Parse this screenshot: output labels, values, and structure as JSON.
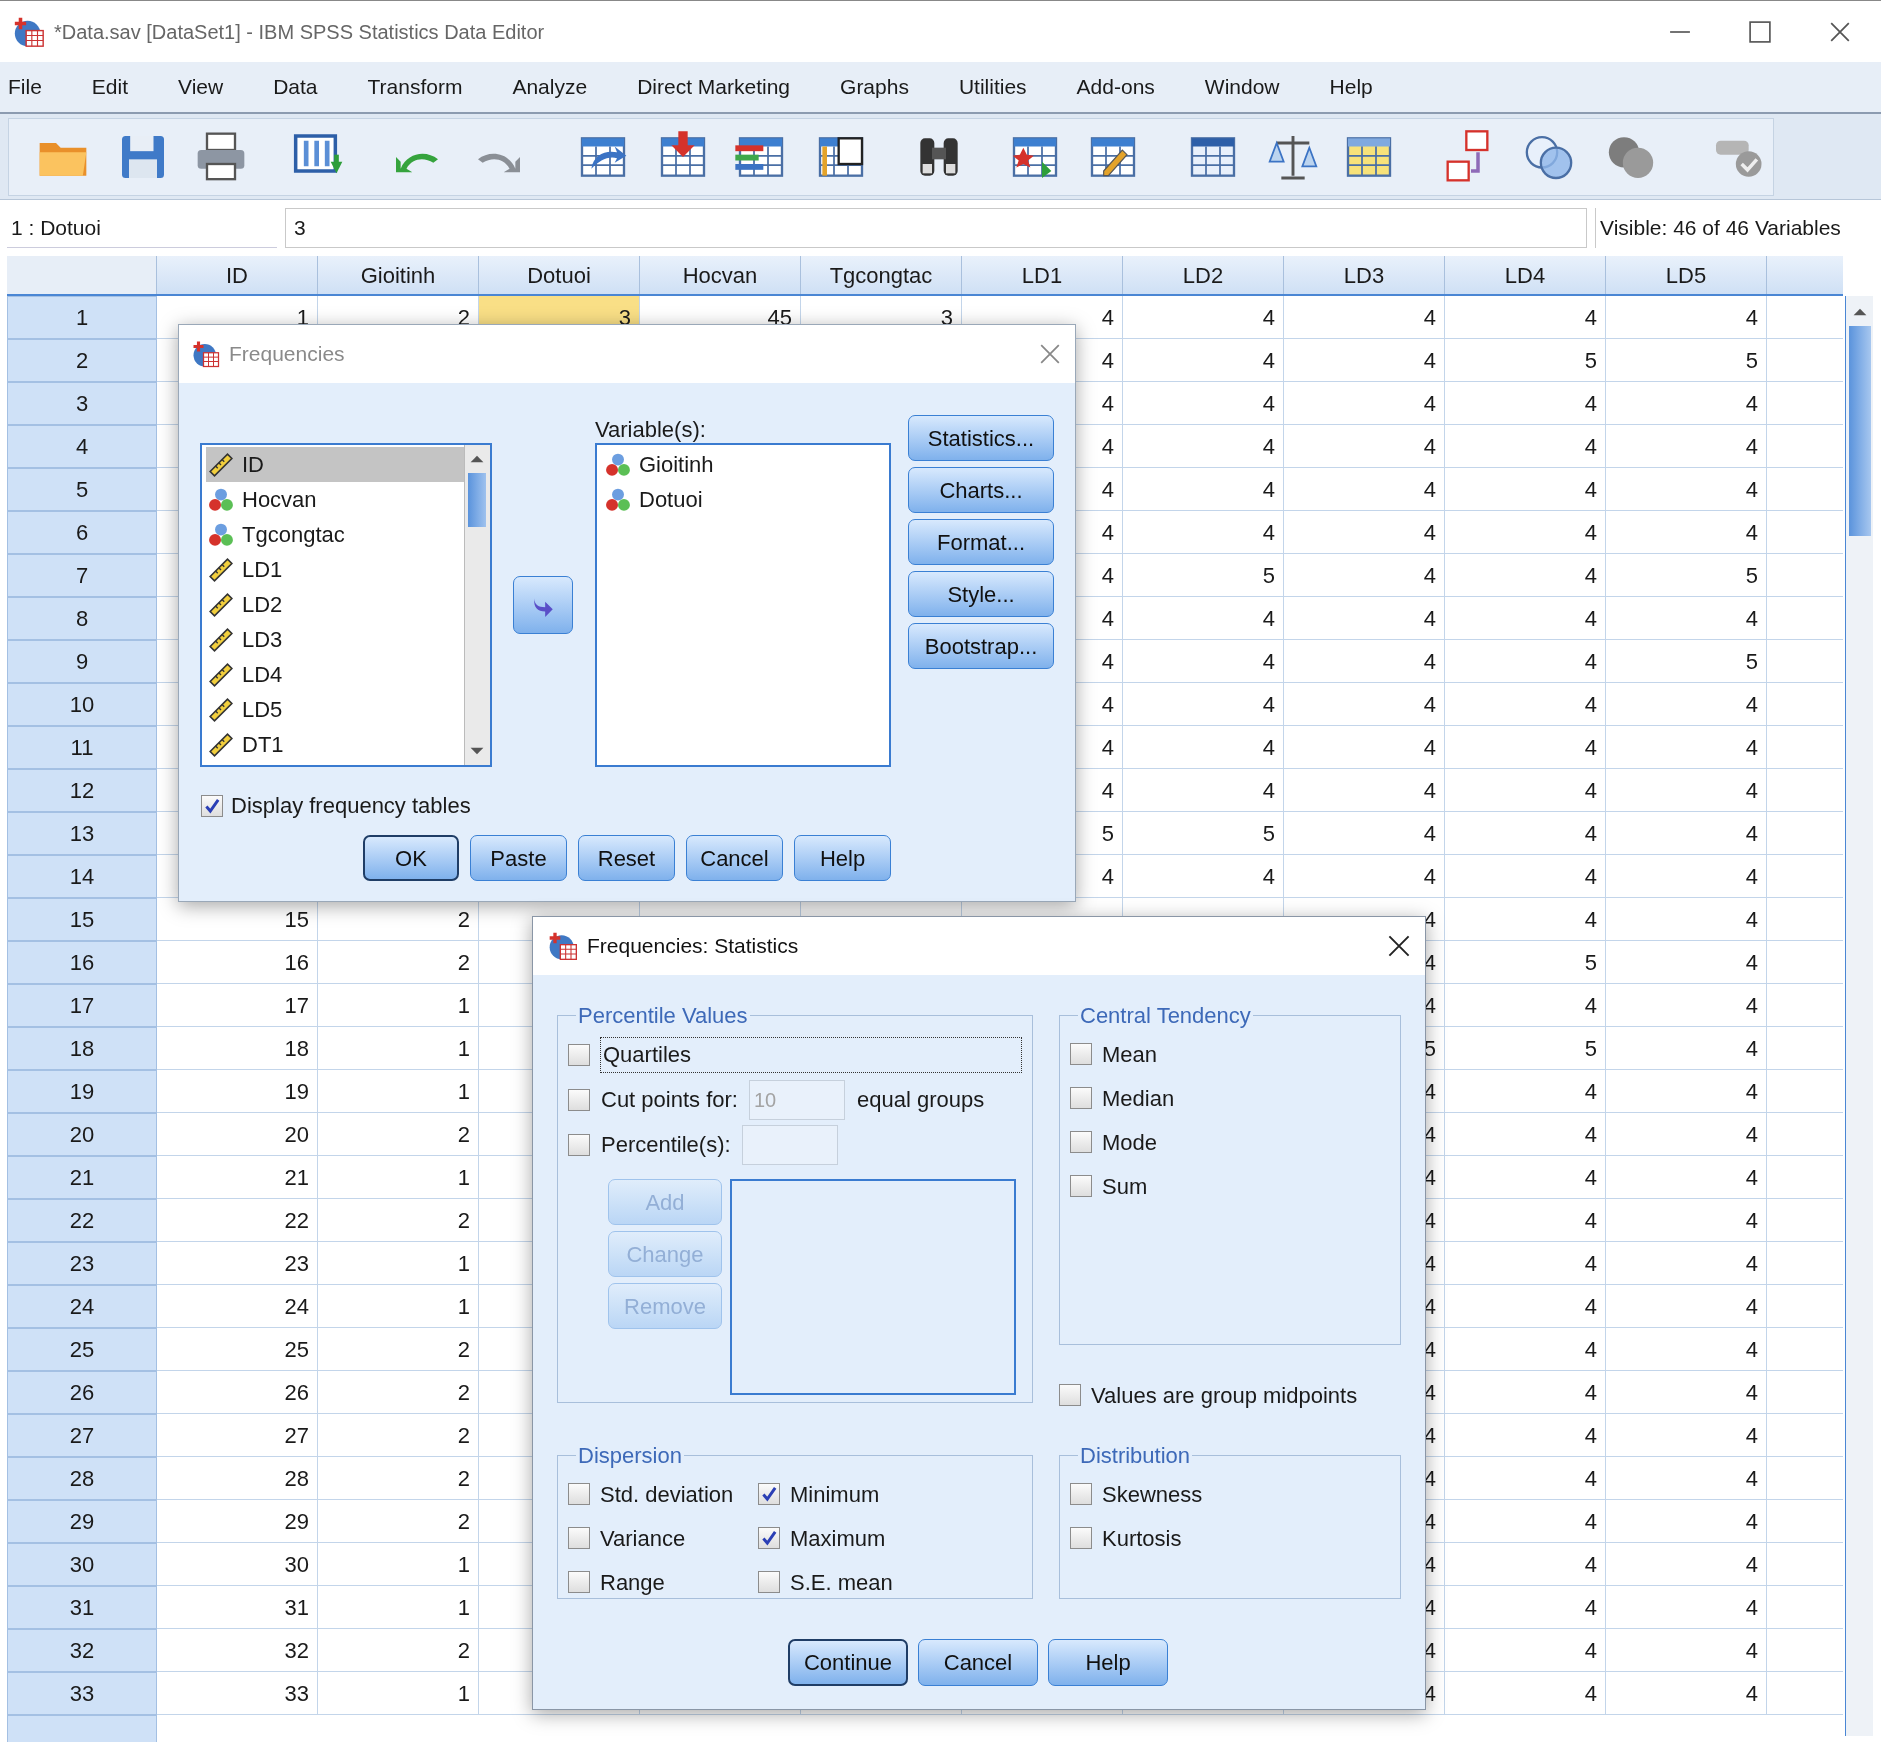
{
  "window": {
    "title": "*Data.sav [DataSet1] - IBM SPSS Statistics Data Editor"
  },
  "menu": [
    "File",
    "Edit",
    "View",
    "Data",
    "Transform",
    "Analyze",
    "Direct Marketing",
    "Graphs",
    "Utilities",
    "Add-ons",
    "Window",
    "Help"
  ],
  "cell_editor": {
    "cell_ref": "1 : Dotuoi",
    "value": "3",
    "visible_count": "Visible: 46 of 46 Variables"
  },
  "grid": {
    "columns": [
      {
        "label": "ID"
      },
      {
        "label": "Gioitinh"
      },
      {
        "label": "Dotuoi"
      },
      {
        "label": "Hocvan"
      },
      {
        "label": "Tgcongtac"
      },
      {
        "label": "LD1"
      },
      {
        "label": "LD2"
      },
      {
        "label": "LD3"
      },
      {
        "label": "LD4"
      },
      {
        "label": "LD5"
      }
    ],
    "rows": [
      {
        "label": "1",
        "cells": [
          {
            "value": "1",
            "selected": false
          },
          {
            "value": "2",
            "selected": false
          },
          {
            "value": "3",
            "selected": true
          },
          {
            "value": "45",
            "selected": false
          },
          {
            "value": "3",
            "selected": false
          },
          {
            "value": "4",
            "selected": false
          },
          {
            "value": "4",
            "selected": false
          },
          {
            "value": "4",
            "selected": false
          },
          {
            "value": "4",
            "selected": false
          },
          {
            "value": "4",
            "selected": false
          }
        ]
      },
      {
        "label": "2",
        "cells": [
          null,
          null,
          null,
          null,
          null,
          {
            "value": "4",
            "selected": false
          },
          {
            "value": "4",
            "selected": false
          },
          {
            "value": "4",
            "selected": false
          },
          {
            "value": "5",
            "selected": false
          },
          {
            "value": "5",
            "selected": false
          }
        ]
      },
      {
        "label": "3",
        "cells": [
          null,
          null,
          null,
          null,
          null,
          {
            "value": "4",
            "selected": false
          },
          {
            "value": "4",
            "selected": false
          },
          {
            "value": "4",
            "selected": false
          },
          {
            "value": "4",
            "selected": false
          },
          {
            "value": "4",
            "selected": false
          }
        ]
      },
      {
        "label": "4",
        "cells": [
          null,
          null,
          null,
          null,
          null,
          {
            "value": "4",
            "selected": false
          },
          {
            "value": "4",
            "selected": false
          },
          {
            "value": "4",
            "selected": false
          },
          {
            "value": "4",
            "selected": false
          },
          {
            "value": "4",
            "selected": false
          }
        ]
      },
      {
        "label": "5",
        "cells": [
          null,
          null,
          null,
          null,
          null,
          {
            "value": "4",
            "selected": false
          },
          {
            "value": "4",
            "selected": false
          },
          {
            "value": "4",
            "selected": false
          },
          {
            "value": "4",
            "selected": false
          },
          {
            "value": "4",
            "selected": false
          }
        ]
      },
      {
        "label": "6",
        "cells": [
          null,
          null,
          null,
          null,
          null,
          {
            "value": "4",
            "selected": false
          },
          {
            "value": "4",
            "selected": false
          },
          {
            "value": "4",
            "selected": false
          },
          {
            "value": "4",
            "selected": false
          },
          {
            "value": "4",
            "selected": false
          }
        ]
      },
      {
        "label": "7",
        "cells": [
          null,
          null,
          null,
          null,
          null,
          {
            "value": "4",
            "selected": false
          },
          {
            "value": "5",
            "selected": false
          },
          {
            "value": "4",
            "selected": false
          },
          {
            "value": "4",
            "selected": false
          },
          {
            "value": "5",
            "selected": false
          }
        ]
      },
      {
        "label": "8",
        "cells": [
          null,
          null,
          null,
          null,
          null,
          {
            "value": "4",
            "selected": false
          },
          {
            "value": "4",
            "selected": false
          },
          {
            "value": "4",
            "selected": false
          },
          {
            "value": "4",
            "selected": false
          },
          {
            "value": "4",
            "selected": false
          }
        ]
      },
      {
        "label": "9",
        "cells": [
          null,
          null,
          null,
          null,
          null,
          {
            "value": "4",
            "selected": false
          },
          {
            "value": "4",
            "selected": false
          },
          {
            "value": "4",
            "selected": false
          },
          {
            "value": "4",
            "selected": false
          },
          {
            "value": "5",
            "selected": false
          }
        ]
      },
      {
        "label": "10",
        "cells": [
          null,
          null,
          null,
          null,
          null,
          {
            "value": "4",
            "selected": false
          },
          {
            "value": "4",
            "selected": false
          },
          {
            "value": "4",
            "selected": false
          },
          {
            "value": "4",
            "selected": false
          },
          {
            "value": "4",
            "selected": false
          }
        ]
      },
      {
        "label": "11",
        "cells": [
          null,
          null,
          null,
          null,
          null,
          {
            "value": "4",
            "selected": false
          },
          {
            "value": "4",
            "selected": false
          },
          {
            "value": "4",
            "selected": false
          },
          {
            "value": "4",
            "selected": false
          },
          {
            "value": "4",
            "selected": false
          }
        ]
      },
      {
        "label": "12",
        "cells": [
          null,
          null,
          null,
          null,
          null,
          {
            "value": "4",
            "selected": false
          },
          {
            "value": "4",
            "selected": false
          },
          {
            "value": "4",
            "selected": false
          },
          {
            "value": "4",
            "selected": false
          },
          {
            "value": "4",
            "selected": false
          }
        ]
      },
      {
        "label": "13",
        "cells": [
          null,
          null,
          null,
          null,
          null,
          {
            "value": "5",
            "selected": false
          },
          {
            "value": "5",
            "selected": false
          },
          {
            "value": "4",
            "selected": false
          },
          {
            "value": "4",
            "selected": false
          },
          {
            "value": "4",
            "selected": false
          }
        ]
      },
      {
        "label": "14",
        "cells": [
          null,
          null,
          null,
          null,
          null,
          {
            "value": "4",
            "selected": false
          },
          {
            "value": "4",
            "selected": false
          },
          {
            "value": "4",
            "selected": false
          },
          {
            "value": "4",
            "selected": false
          },
          {
            "value": "4",
            "selected": false
          }
        ]
      },
      {
        "label": "15",
        "cells": [
          {
            "value": "15",
            "selected": false
          },
          {
            "value": "2",
            "selected": false
          },
          null,
          null,
          null,
          null,
          null,
          {
            "value": "4",
            "selected": false
          },
          {
            "value": "4",
            "selected": false
          },
          {
            "value": "4",
            "selected": false
          }
        ]
      },
      {
        "label": "16",
        "cells": [
          {
            "value": "16",
            "selected": false
          },
          {
            "value": "2",
            "selected": false
          },
          null,
          null,
          null,
          null,
          null,
          {
            "value": "4",
            "selected": false
          },
          {
            "value": "5",
            "selected": false
          },
          {
            "value": "4",
            "selected": false
          }
        ]
      },
      {
        "label": "17",
        "cells": [
          {
            "value": "17",
            "selected": false
          },
          {
            "value": "1",
            "selected": false
          },
          null,
          null,
          null,
          null,
          null,
          {
            "value": "4",
            "selected": false
          },
          {
            "value": "4",
            "selected": false
          },
          {
            "value": "4",
            "selected": false
          }
        ]
      },
      {
        "label": "18",
        "cells": [
          {
            "value": "18",
            "selected": false
          },
          {
            "value": "1",
            "selected": false
          },
          null,
          null,
          null,
          null,
          null,
          {
            "value": "5",
            "selected": false
          },
          {
            "value": "5",
            "selected": false
          },
          {
            "value": "4",
            "selected": false
          }
        ]
      },
      {
        "label": "19",
        "cells": [
          {
            "value": "19",
            "selected": false
          },
          {
            "value": "1",
            "selected": false
          },
          null,
          null,
          null,
          null,
          null,
          {
            "value": "4",
            "selected": false
          },
          {
            "value": "4",
            "selected": false
          },
          {
            "value": "4",
            "selected": false
          }
        ]
      },
      {
        "label": "20",
        "cells": [
          {
            "value": "20",
            "selected": false
          },
          {
            "value": "2",
            "selected": false
          },
          null,
          null,
          null,
          null,
          null,
          {
            "value": "4",
            "selected": false
          },
          {
            "value": "4",
            "selected": false
          },
          {
            "value": "4",
            "selected": false
          }
        ]
      },
      {
        "label": "21",
        "cells": [
          {
            "value": "21",
            "selected": false
          },
          {
            "value": "1",
            "selected": false
          },
          null,
          null,
          null,
          null,
          null,
          {
            "value": "4",
            "selected": false
          },
          {
            "value": "4",
            "selected": false
          },
          {
            "value": "4",
            "selected": false
          }
        ]
      },
      {
        "label": "22",
        "cells": [
          {
            "value": "22",
            "selected": false
          },
          {
            "value": "2",
            "selected": false
          },
          null,
          null,
          null,
          null,
          null,
          {
            "value": "4",
            "selected": false
          },
          {
            "value": "4",
            "selected": false
          },
          {
            "value": "4",
            "selected": false
          }
        ]
      },
      {
        "label": "23",
        "cells": [
          {
            "value": "23",
            "selected": false
          },
          {
            "value": "1",
            "selected": false
          },
          null,
          null,
          null,
          null,
          null,
          {
            "value": "4",
            "selected": false
          },
          {
            "value": "4",
            "selected": false
          },
          {
            "value": "4",
            "selected": false
          }
        ]
      },
      {
        "label": "24",
        "cells": [
          {
            "value": "24",
            "selected": false
          },
          {
            "value": "1",
            "selected": false
          },
          null,
          null,
          null,
          null,
          null,
          {
            "value": "4",
            "selected": false
          },
          {
            "value": "4",
            "selected": false
          },
          {
            "value": "4",
            "selected": false
          }
        ]
      },
      {
        "label": "25",
        "cells": [
          {
            "value": "25",
            "selected": false
          },
          {
            "value": "2",
            "selected": false
          },
          null,
          null,
          null,
          null,
          null,
          {
            "value": "4",
            "selected": false
          },
          {
            "value": "4",
            "selected": false
          },
          {
            "value": "4",
            "selected": false
          }
        ]
      },
      {
        "label": "26",
        "cells": [
          {
            "value": "26",
            "selected": false
          },
          {
            "value": "2",
            "selected": false
          },
          null,
          null,
          null,
          null,
          null,
          {
            "value": "4",
            "selected": false
          },
          {
            "value": "4",
            "selected": false
          },
          {
            "value": "4",
            "selected": false
          }
        ]
      },
      {
        "label": "27",
        "cells": [
          {
            "value": "27",
            "selected": false
          },
          {
            "value": "2",
            "selected": false
          },
          null,
          null,
          null,
          null,
          null,
          {
            "value": "4",
            "selected": false
          },
          {
            "value": "4",
            "selected": false
          },
          {
            "value": "4",
            "selected": false
          }
        ]
      },
      {
        "label": "28",
        "cells": [
          {
            "value": "28",
            "selected": false
          },
          {
            "value": "2",
            "selected": false
          },
          null,
          null,
          null,
          null,
          null,
          {
            "value": "4",
            "selected": false
          },
          {
            "value": "4",
            "selected": false
          },
          {
            "value": "4",
            "selected": false
          }
        ]
      },
      {
        "label": "29",
        "cells": [
          {
            "value": "29",
            "selected": false
          },
          {
            "value": "2",
            "selected": false
          },
          null,
          null,
          null,
          null,
          null,
          {
            "value": "4",
            "selected": false
          },
          {
            "value": "4",
            "selected": false
          },
          {
            "value": "4",
            "selected": false
          }
        ]
      },
      {
        "label": "30",
        "cells": [
          {
            "value": "30",
            "selected": false
          },
          {
            "value": "1",
            "selected": false
          },
          null,
          null,
          null,
          null,
          null,
          {
            "value": "4",
            "selected": false
          },
          {
            "value": "4",
            "selected": false
          },
          {
            "value": "4",
            "selected": false
          }
        ]
      },
      {
        "label": "31",
        "cells": [
          {
            "value": "31",
            "selected": false
          },
          {
            "value": "1",
            "selected": false
          },
          null,
          null,
          null,
          null,
          null,
          {
            "value": "4",
            "selected": false
          },
          {
            "value": "4",
            "selected": false
          },
          {
            "value": "4",
            "selected": false
          }
        ]
      },
      {
        "label": "32",
        "cells": [
          {
            "value": "32",
            "selected": false
          },
          {
            "value": "2",
            "selected": false
          },
          null,
          null,
          null,
          null,
          null,
          {
            "value": "4",
            "selected": false
          },
          {
            "value": "4",
            "selected": false
          },
          {
            "value": "4",
            "selected": false
          }
        ]
      },
      {
        "label": "33",
        "cells": [
          {
            "value": "33",
            "selected": false
          },
          {
            "value": "1",
            "selected": false
          },
          null,
          null,
          null,
          null,
          null,
          {
            "value": "4",
            "selected": false
          },
          {
            "value": "4",
            "selected": false
          },
          {
            "value": "4",
            "selected": false
          }
        ]
      }
    ]
  },
  "frequencies_dialog": {
    "title": "Frequencies",
    "source_variables": [
      {
        "name": "ID",
        "kind": "scale",
        "selected": true
      },
      {
        "name": "Hocvan",
        "kind": "nominal",
        "selected": false
      },
      {
        "name": "Tgcongtac",
        "kind": "nominal",
        "selected": false
      },
      {
        "name": "LD1",
        "kind": "scale",
        "selected": false
      },
      {
        "name": "LD2",
        "kind": "scale",
        "selected": false
      },
      {
        "name": "LD3",
        "kind": "scale",
        "selected": false
      },
      {
        "name": "LD4",
        "kind": "scale",
        "selected": false
      },
      {
        "name": "LD5",
        "kind": "scale",
        "selected": false
      },
      {
        "name": "DT1",
        "kind": "scale",
        "selected": false
      }
    ],
    "target_label": "Variable(s):",
    "target_variables": [
      {
        "name": "Gioitinh",
        "kind": "nominal",
        "selected": false
      },
      {
        "name": "Dotuoi",
        "kind": "nominal",
        "selected": false
      }
    ],
    "side_buttons": [
      "Statistics...",
      "Charts...",
      "Format...",
      "Style...",
      "Bootstrap..."
    ],
    "display_frequency_tables": {
      "label": "Display frequency tables",
      "checked": true
    },
    "buttons": [
      {
        "label": "OK",
        "default": true
      },
      {
        "label": "Paste",
        "default": false
      },
      {
        "label": "Reset",
        "default": false
      },
      {
        "label": "Cancel",
        "default": false
      },
      {
        "label": "Help",
        "default": false
      }
    ]
  },
  "statistics_dialog": {
    "title": "Frequencies: Statistics",
    "percentile_values": {
      "title": "Percentile Values",
      "options": [
        {
          "kind": "plain",
          "label": "Quartiles",
          "checked": false,
          "focused": true
        },
        {
          "kind": "field",
          "label": "Cut points for:",
          "checked": false,
          "focused": false,
          "value": "10",
          "disabled": true,
          "suffix": "equal groups"
        },
        {
          "kind": "field",
          "label": "Percentile(s):",
          "checked": false,
          "focused": false,
          "disabled": true
        }
      ],
      "list_buttons": [
        {
          "label": "Add",
          "disabled": true
        },
        {
          "label": "Change",
          "disabled": true
        },
        {
          "label": "Remove",
          "disabled": true
        }
      ]
    },
    "central_tendency": {
      "title": "Central Tendency",
      "options": [
        {
          "label": "Mean",
          "checked": false
        },
        {
          "label": "Median",
          "checked": false
        },
        {
          "label": "Mode",
          "checked": false
        },
        {
          "label": "Sum",
          "checked": false
        }
      ]
    },
    "group_midpoints": {
      "label": "Values are group midpoints",
      "checked": false
    },
    "dispersion": {
      "title": "Dispersion",
      "options": [
        {
          "label": "Std. deviation",
          "checked": false
        },
        {
          "label": "Minimum",
          "checked": true
        },
        {
          "label": "Variance",
          "checked": false
        },
        {
          "label": "Maximum",
          "checked": true
        },
        {
          "label": "Range",
          "checked": false
        },
        {
          "label": "S.E. mean",
          "checked": false
        }
      ]
    },
    "distribution": {
      "title": "Distribution",
      "options": [
        {
          "label": "Skewness",
          "checked": false
        },
        {
          "label": "Kurtosis",
          "checked": false
        }
      ]
    },
    "buttons": [
      {
        "label": "Continue",
        "default": true
      },
      {
        "label": "Cancel",
        "default": false
      },
      {
        "label": "Help",
        "default": false
      }
    ]
  }
}
